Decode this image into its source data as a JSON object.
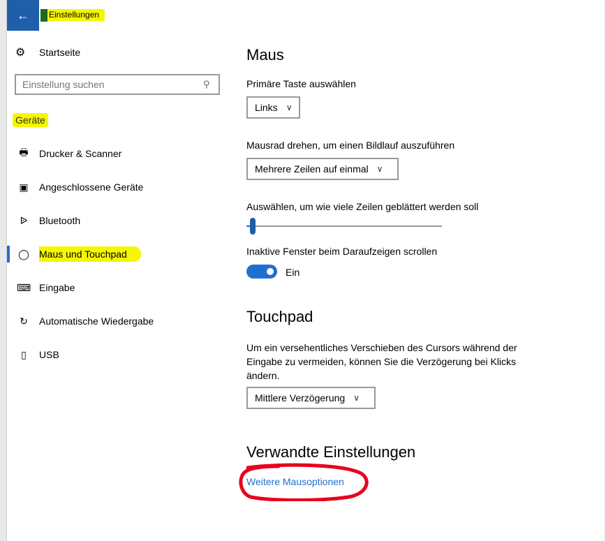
{
  "window": {
    "title": "Einstellungen",
    "back_icon": "back-arrow-icon"
  },
  "sidebar": {
    "home_label": "Startseite",
    "search_placeholder": "Einstellung suchen",
    "section_title": "Geräte",
    "items": [
      {
        "label": "Drucker & Scanner",
        "icon": "printer-icon"
      },
      {
        "label": "Angeschlossene Geräte",
        "icon": "devices-icon"
      },
      {
        "label": "Bluetooth",
        "icon": "bluetooth-icon"
      },
      {
        "label": "Maus und Touchpad",
        "icon": "mouse-icon",
        "active": true
      },
      {
        "label": "Eingabe",
        "icon": "keyboard-icon"
      },
      {
        "label": "Automatische Wiedergabe",
        "icon": "autoplay-icon"
      },
      {
        "label": "USB",
        "icon": "usb-icon"
      }
    ]
  },
  "main": {
    "mouse_heading": "Maus",
    "primary_button_label": "Primäre Taste auswählen",
    "primary_button_value": "Links",
    "scroll_label": "Mausrad drehen, um einen Bildlauf auszuführen",
    "scroll_value": "Mehrere Zeilen auf einmal",
    "lines_label": "Auswählen, um wie viele Zeilen geblättert werden soll",
    "lines_slider_fraction": 0.02,
    "inactive_scroll_label": "Inaktive Fenster beim Daraufzeigen scrollen",
    "inactive_scroll_state": "Ein",
    "touchpad_heading": "Touchpad",
    "touchpad_description": "Um ein versehentliches Verschieben des Cursors während der Eingabe zu vermeiden, können Sie die Verzögerung bei Klicks ändern.",
    "touchpad_delay_value": "Mittlere Verzögerung",
    "related_heading": "Verwandte Einstellungen",
    "related_link": "Weitere Mausoptionen"
  },
  "colors": {
    "accent": "#1f6fd1",
    "highlight": "#f6f600",
    "annotation": "#e8001c"
  }
}
